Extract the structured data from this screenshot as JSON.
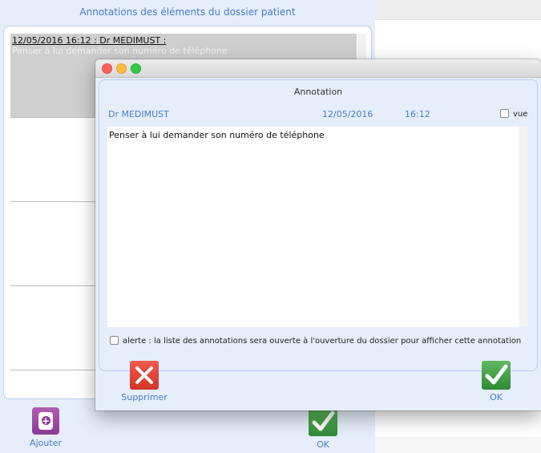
{
  "background": {
    "title": "Annotations des éléments du dossier patient",
    "rows": [
      {
        "header": "12/05/2016 16:12 : Dr MEDIMUST :",
        "body": "Penser à lui demander son numéro de téléphone"
      }
    ],
    "ajouter_label": "Ajouter",
    "ok_label": "OK"
  },
  "dialog": {
    "title": "Annotation",
    "author": "Dr MEDIMUST",
    "date": "12/05/2016",
    "time": "16:12",
    "vue_label": "vue",
    "text": "Penser à lui demander son numéro de téléphone",
    "alerte_label": "alerte : la liste des annotations sera ouverte à l'ouverture du dossier pour afficher cette annotation",
    "supprimer_label": "Supprimer",
    "ok_label": "OK"
  },
  "colors": {
    "accent_text": "#4a7bc8",
    "panel_bg": "#e6eefb",
    "ok_green": "#2f8a35",
    "delete_red": "#d13428",
    "add_purple": "#8a3b93"
  },
  "icons": [
    "close-window-icon",
    "minimize-window-icon",
    "zoom-window-icon",
    "add-annotation-icon",
    "check-icon",
    "delete-x-icon"
  ]
}
